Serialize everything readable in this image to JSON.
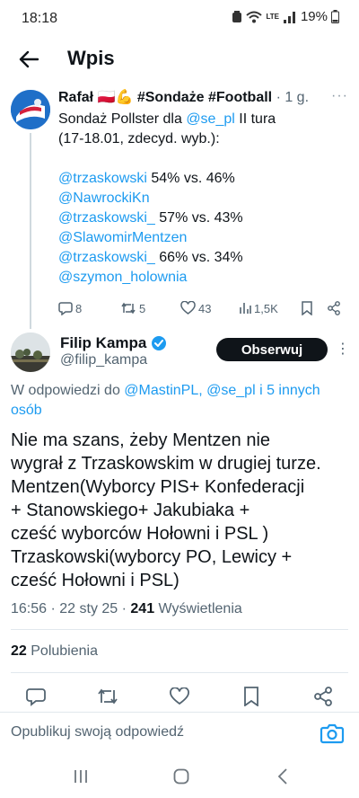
{
  "status_bar": {
    "time": "18:18",
    "network_label": "LTE",
    "battery": "19%"
  },
  "header": {
    "title": "Wpis"
  },
  "parent_tweet": {
    "display_name": "Rafał 🇵🇱💪 #Sondaże #Football",
    "time": "· 1 g.",
    "more": "···",
    "text_line1_prefix": "Sondaż Pollster dla ",
    "text_line1_mention": "@se_pl",
    "text_line1_suffix": " II tura",
    "text_line2": "(17-18.01, zdecyd. wyb.):",
    "results": [
      {
        "mention": "@trzaskowski",
        "score": " 54% vs. 46%",
        "opponent": "@NawrockiKn"
      },
      {
        "mention": "@trzaskowski_",
        "score": " 57% vs. 43%",
        "opponent": "@SlawomirMentzen"
      },
      {
        "mention": "@trzaskowski_",
        "score": " 66% vs. 34%",
        "opponent": "@szymon_holownia"
      }
    ],
    "actions": {
      "replies": "8",
      "reposts": "5",
      "likes": "43",
      "views": "1,5K"
    }
  },
  "main_tweet": {
    "display_name": "Filip Kampa",
    "handle": "@filip_kampa",
    "follow_label": "Obserwuj",
    "more": "⋮",
    "reply_prefix": "W odpowiedzi do ",
    "reply_targets": "@MastinPL, @se_pl i 5 innych osób",
    "body": [
      "Nie ma szans, żeby Mentzen nie",
      "wygrał z Trzaskowskim w drugiej turze.",
      "Mentzen(Wyborcy PIS+ Konfederacji",
      "+ Stanowskiego+ Jakubiaka +",
      "cześć wyborców Hołowni i PSL )",
      "Trzaskowski(wyborcy PO, Lewicy +",
      "cześć Hołowni i PSL)"
    ],
    "timestamp": "16:56 · 22 sty 25 · ",
    "views_count": "241",
    "views_label": " Wyświetlenia",
    "likes_count": "22",
    "likes_label": " Polubienia"
  },
  "reply_bar": {
    "placeholder": "Opublikuj swoją odpowiedź"
  },
  "colors": {
    "link": "#1d9bf0",
    "verified": "#1d9bf0",
    "follow_button": "#0f1419",
    "muted_text": "#536471"
  },
  "icons": [
    "back-arrow-icon",
    "reply-icon",
    "repost-icon",
    "heart-icon",
    "views-icon",
    "bookmark-icon",
    "share-icon",
    "camera-icon",
    "verified-badge-icon"
  ]
}
